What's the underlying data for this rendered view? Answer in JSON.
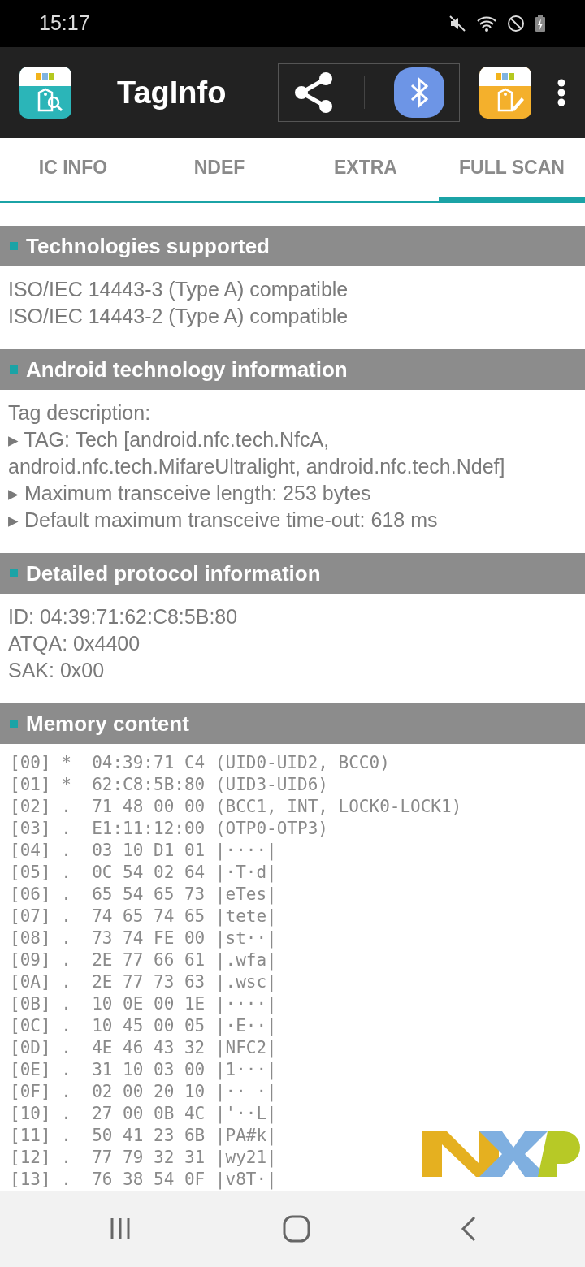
{
  "status_bar": {
    "time": "15:17"
  },
  "app_bar": {
    "title": "TagInfo"
  },
  "tabs": [
    {
      "label": "IC INFO",
      "selected": false
    },
    {
      "label": "NDEF",
      "selected": false
    },
    {
      "label": "EXTRA",
      "selected": false
    },
    {
      "label": "FULL SCAN",
      "selected": true
    }
  ],
  "sections": [
    {
      "title": "Technologies supported",
      "kind": "text",
      "lines": [
        "ISO/IEC 14443-3 (Type A) compatible",
        "ISO/IEC 14443-2 (Type A) compatible"
      ]
    },
    {
      "title": "Android technology information",
      "kind": "text",
      "lines": [
        "Tag description:",
        "▸ TAG: Tech [android.nfc.tech.NfcA, android.nfc.tech.MifareUltralight, android.nfc.tech.Ndef]",
        "▸ Maximum transceive length: 253 bytes",
        "▸ Default maximum transceive time-out: 618 ms"
      ]
    },
    {
      "title": "Detailed protocol information",
      "kind": "text",
      "lines": [
        "ID: 04:39:71:62:C8:5B:80",
        "ATQA: 0x4400",
        "SAK: 0x00"
      ]
    },
    {
      "title": "Memory content",
      "kind": "mono",
      "lines": [
        "[00] *  04:39:71 C4 (UID0-UID2, BCC0)",
        "[01] *  62:C8:5B:80 (UID3-UID6)",
        "[02] .  71 48 00 00 (BCC1, INT, LOCK0-LOCK1)",
        "[03] .  E1:11:12:00 (OTP0-OTP3)",
        "[04] .  03 10 D1 01 |····|",
        "[05] .  0C 54 02 64 |·T·d|",
        "[06] .  65 54 65 73 |eTes|",
        "[07] .  74 65 74 65 |tete|",
        "[08] .  73 74 FE 00 |st··|",
        "[09] .  2E 77 66 61 |.wfa|",
        "[0A] .  2E 77 73 63 |.wsc|",
        "[0B] .  10 0E 00 1E |····|",
        "[0C] .  10 45 00 05 |·E··|",
        "[0D] .  4E 46 43 32 |NFC2|",
        "[0E] .  31 10 03 00 |1···|",
        "[0F] .  02 00 20 10 |·· ·|",
        "[10] .  27 00 0B 4C |'··L|",
        "[11] .  50 41 23 6B |PA#k|",
        "[12] .  77 79 32 31 |wy21|",
        "[13] .  76 38 54 0F |v8T·|"
      ]
    }
  ]
}
